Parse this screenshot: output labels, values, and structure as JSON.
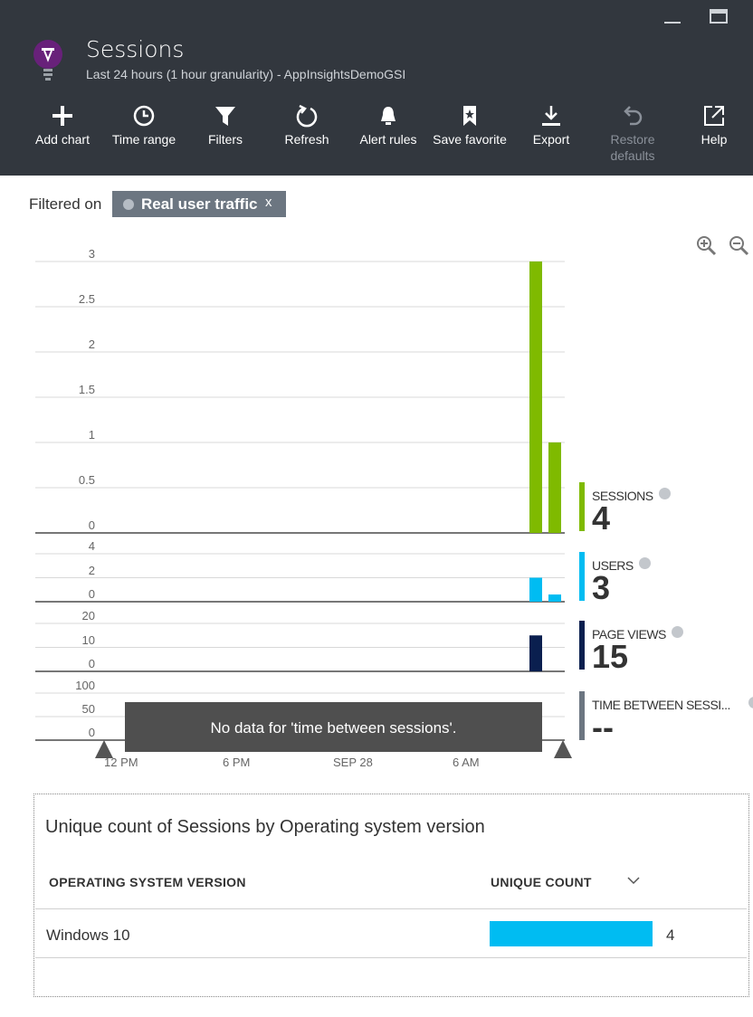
{
  "blade": {
    "title": "Sessions",
    "subtitle": "Last 24 hours (1 hour granularity) - AppInsightsDemoGSI"
  },
  "toolbar": [
    {
      "label": "Add chart",
      "icon": "plus-icon"
    },
    {
      "label": "Time range",
      "icon": "clock-icon"
    },
    {
      "label": "Filters",
      "icon": "funnel-icon"
    },
    {
      "label": "Refresh",
      "icon": "refresh-icon"
    },
    {
      "label": "Alert rules",
      "icon": "bell-icon"
    },
    {
      "label": "Save favorite",
      "icon": "bookmark-star-icon"
    },
    {
      "label": "Export",
      "icon": "download-icon"
    },
    {
      "label": "Restore defaults",
      "icon": "undo-icon",
      "disabled": true
    },
    {
      "label": "Help",
      "icon": "external-link-icon"
    }
  ],
  "filter": {
    "label": "Filtered on",
    "chip": "Real user traffic",
    "remove": "x"
  },
  "colors": {
    "sessions": "#7fba00",
    "users": "#00bcf2",
    "page_views": "#0a1f4f",
    "time_between": "#6c7681",
    "header": "#32373e"
  },
  "chart_data": {
    "type": "bar",
    "x_ticks": [
      "12 PM",
      "6 PM",
      "SEP 28",
      "6 AM"
    ],
    "panels": [
      {
        "name": "SESSIONS",
        "yticks": [
          "3",
          "2.5",
          "2",
          "1.5",
          "1",
          "0.5",
          "0"
        ],
        "ylim": [
          0,
          3
        ],
        "values": [
          3,
          1
        ]
      },
      {
        "name": "USERS",
        "yticks": [
          "4",
          "2",
          "0"
        ],
        "ylim": [
          0,
          4
        ],
        "values": [
          2,
          0.6
        ]
      },
      {
        "name": "PAGE VIEWS",
        "yticks": [
          "20",
          "10",
          "0"
        ],
        "ylim": [
          0,
          20
        ],
        "values": [
          15
        ]
      },
      {
        "name": "TIME BETWEEN SESSIONS",
        "yticks": [
          "100",
          "50",
          "0"
        ],
        "ylim": [
          0,
          100
        ],
        "values": []
      }
    ],
    "no_data_message": "No data for 'time between sessions'."
  },
  "metrics": [
    {
      "label": "SESSIONS",
      "value": "4"
    },
    {
      "label": "USERS",
      "value": "3"
    },
    {
      "label": "PAGE VIEWS",
      "value": "15"
    },
    {
      "label": "TIME BETWEEN SESSI...",
      "value": "--"
    }
  ],
  "grid": {
    "title": "Unique count of Sessions by Operating system version",
    "col1": "OPERATING SYSTEM VERSION",
    "col2": "UNIQUE COUNT",
    "rows": [
      {
        "name": "Windows 10",
        "count": "4",
        "fraction": 1.0
      }
    ]
  }
}
